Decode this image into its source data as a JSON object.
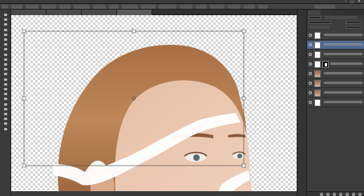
{
  "app": {
    "name": "Photoshop"
  },
  "icons": {
    "menubar": "menu-icon",
    "window_controls": [
      "minimize-icon",
      "maximize-icon",
      "close-icon"
    ],
    "tools": [
      "move-tool-icon",
      "marquee-tool-icon",
      "lasso-tool-icon",
      "quick-select-tool-icon",
      "crop-tool-icon",
      "eyedropper-tool-icon",
      "healing-brush-icon",
      "brush-tool-icon",
      "clone-stamp-icon",
      "history-brush-icon",
      "eraser-tool-icon",
      "gradient-tool-icon",
      "blur-tool-icon",
      "dodge-tool-icon",
      "pen-tool-icon",
      "type-tool-icon",
      "path-select-icon",
      "shape-tool-icon",
      "hand-tool-icon",
      "zoom-tool-icon",
      "foreground-color-icon",
      "background-color-icon",
      "quick-mask-icon",
      "screen-mode-icon"
    ],
    "layers_footer": [
      "link-layers-icon",
      "fx-icon",
      "add-mask-icon",
      "adjustment-icon",
      "group-icon",
      "new-layer-icon",
      "trash-icon"
    ]
  },
  "colors": {
    "selected_layer": "#4e6a90",
    "hair": "#b97f52",
    "skin": "#e7c3ac"
  },
  "layers": [
    {
      "name": "",
      "selected": false,
      "thumb": "blank"
    },
    {
      "name": "",
      "selected": true,
      "thumb": "blank"
    },
    {
      "name": "",
      "selected": false,
      "thumb": "blank"
    },
    {
      "name": "",
      "selected": false,
      "thumb": "mask"
    },
    {
      "name": "",
      "selected": false,
      "thumb": "photo"
    },
    {
      "name": "",
      "selected": false,
      "thumb": "photo"
    },
    {
      "name": "",
      "selected": false,
      "thumb": "photo"
    },
    {
      "name": "",
      "selected": false,
      "thumb": "blank"
    }
  ]
}
